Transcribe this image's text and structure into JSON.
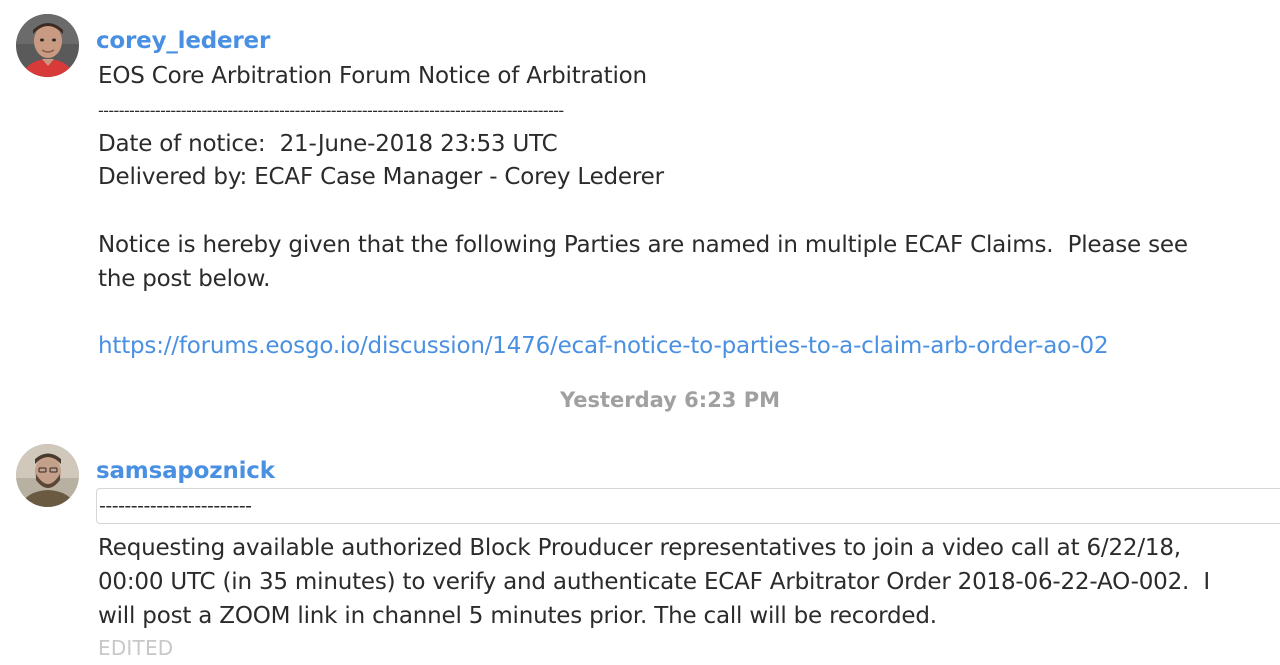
{
  "messages": [
    {
      "username": "corey_lederer",
      "avatar": "user-photo-avatar",
      "lines": {
        "title": "EOS Core Arbitration Forum Notice of Arbitration",
        "divider": "------------------------------------------------------------------------------------------",
        "date": "Date of notice:  21-June-2018 23:53 UTC",
        "delivered": "Delivered by: ECAF Case Manager - Corey Lederer",
        "notice_1": "Notice is hereby given that the following Parties are named in multiple ECAF Claims.  Please see",
        "notice_2": "the post below.",
        "link": "https://forums.eosgo.io/discussion/1476/ecaf-notice-to-parties-to-a-claim-arb-order-ao-02"
      }
    },
    {
      "username": "samsapoznick",
      "avatar": "user-photo-avatar",
      "quote": "------------------------",
      "lines": {
        "line_1": "Requesting available authorized Block Prouducer representatives to join a video call at 6/22/18,",
        "line_2": "00:00 UTC (in 35 minutes) to verify and authenticate ECAF Arbitrator Order 2018-06-22-AO-002.  I",
        "line_3": "will post a ZOOM link in channel 5 minutes prior. The call will be recorded."
      },
      "edited_label": "EDITED"
    }
  ],
  "separator": {
    "timestamp": "Yesterday 6:23 PM"
  },
  "colors": {
    "username": "#4a90e2",
    "link": "#4a90e2",
    "timestamp": "#a0a0a0",
    "edited": "#c8c8c8",
    "text": "#2b2b2b"
  }
}
